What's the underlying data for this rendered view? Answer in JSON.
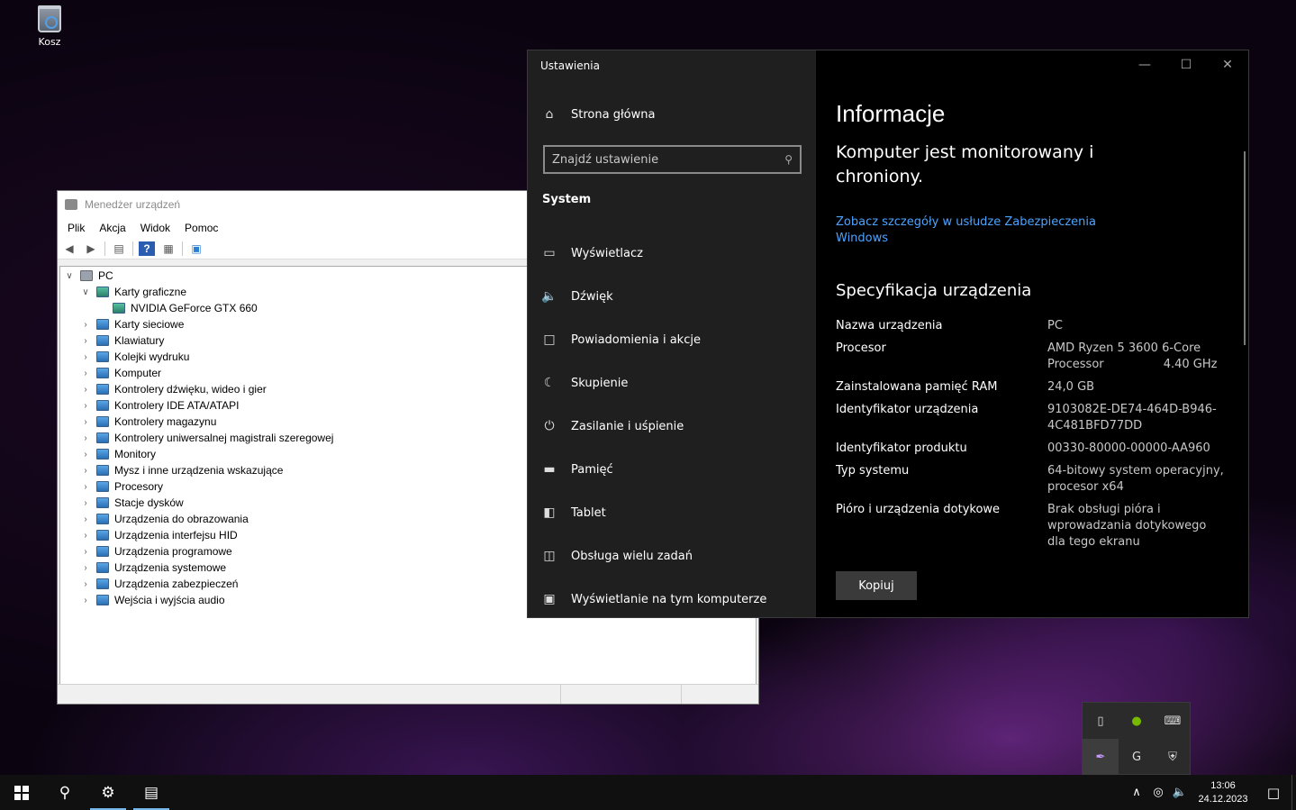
{
  "desktop": {
    "recycle_bin_label": "Kosz"
  },
  "device_manager": {
    "title": "Menedżer urządzeń",
    "menu": [
      "Plik",
      "Akcja",
      "Widok",
      "Pomoc"
    ],
    "root": "PC",
    "expanded_category": "Karty graficzne",
    "expanded_child": "NVIDIA GeForce GTX 660",
    "categories": [
      "Karty sieciowe",
      "Klawiatury",
      "Kolejki wydruku",
      "Komputer",
      "Kontrolery dźwięku, wideo i gier",
      "Kontrolery IDE ATA/ATAPI",
      "Kontrolery magazynu",
      "Kontrolery uniwersalnej magistrali szeregowej",
      "Monitory",
      "Mysz i inne urządzenia wskazujące",
      "Procesory",
      "Stacje dysków",
      "Urządzenia do obrazowania",
      "Urządzenia interfejsu HID",
      "Urządzenia programowe",
      "Urządzenia systemowe",
      "Urządzenia zabezpieczeń",
      "Wejścia i wyjścia audio"
    ]
  },
  "settings": {
    "title": "Ustawienia",
    "home": "Strona główna",
    "search_placeholder": "Znajdź ustawienie",
    "group": "System",
    "nav": [
      {
        "label": "Wyświetlacz",
        "icon": "monitor-icon"
      },
      {
        "label": "Dźwięk",
        "icon": "speaker-icon"
      },
      {
        "label": "Powiadomienia i akcje",
        "icon": "notification-icon"
      },
      {
        "label": "Skupienie",
        "icon": "moon-icon"
      },
      {
        "label": "Zasilanie i uśpienie",
        "icon": "power-icon"
      },
      {
        "label": "Pamięć",
        "icon": "storage-icon"
      },
      {
        "label": "Tablet",
        "icon": "tablet-icon"
      },
      {
        "label": "Obsługa wielu zadań",
        "icon": "multitask-icon"
      },
      {
        "label": "Wyświetlanie na tym komputerze",
        "icon": "project-icon"
      }
    ],
    "page_title": "Informacje",
    "protection_text": "Komputer jest monitorowany i chroniony.",
    "security_link": "Zobacz szczegóły w usłudze Zabezpieczenia Windows",
    "spec_title": "Specyfikacja urządzenia",
    "specs": [
      {
        "k": "Nazwa urządzenia",
        "v": "PC"
      },
      {
        "k": "Procesor",
        "v": "AMD Ryzen 5 3600 6-Core Processor                4.40 GHz"
      },
      {
        "k": "Zainstalowana pamięć RAM",
        "v": "24,0 GB"
      },
      {
        "k": "Identyfikator urządzenia",
        "v": "9103082E-DE74-464D-B946-4C481BFD77DD"
      },
      {
        "k": "Identyfikator produktu",
        "v": "00330-80000-00000-AA960"
      },
      {
        "k": "Typ systemu",
        "v": "64-bitowy system operacyjny, procesor x64"
      },
      {
        "k": "Pióro i urządzenia dotykowe",
        "v": "Brak obsługi pióra i wprowadzania dotykowego dla tego ekranu"
      }
    ],
    "copy_button": "Kopiuj"
  },
  "taskbar": {
    "time": "13:06",
    "date": "24.12.2023"
  }
}
